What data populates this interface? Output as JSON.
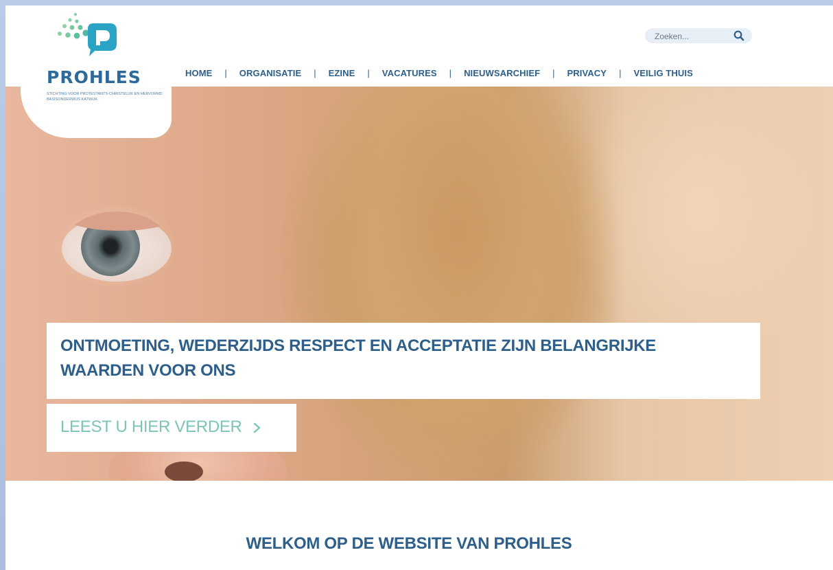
{
  "brand": {
    "name": "PROHLES",
    "tagline": "STICHTING VOOR PROTESTANTS-CHRISTELIJK EN HERVORMD BASISONDERWIJS KATWIJK",
    "colors": {
      "primary": "#2d5f8a",
      "accent": "#7cc4b6",
      "logo_teal": "#2aa3c4",
      "logo_green": "#7cc9a0"
    }
  },
  "search": {
    "placeholder": "Zoeken...",
    "icon": "search-icon"
  },
  "nav": {
    "items": [
      {
        "label": "HOME"
      },
      {
        "label": "ORGANISATIE"
      },
      {
        "label": "EZINE"
      },
      {
        "label": "VACATURES"
      },
      {
        "label": "NIEUWSARCHIEF"
      },
      {
        "label": "PRIVACY"
      },
      {
        "label": "VEILIG THUIS"
      }
    ],
    "separator": "|"
  },
  "hero": {
    "title": "ONTMOETING, WEDERZIJDS RESPECT EN ACCEPTATIE ZIJN BELANGRIJKE WAARDEN VOOR ONS",
    "cta": "LEEST U HIER VERDER",
    "cta_icon": "chevron-right-icon"
  },
  "welcome": {
    "title": "WELKOM OP DE WEBSITE VAN PROHLES"
  }
}
